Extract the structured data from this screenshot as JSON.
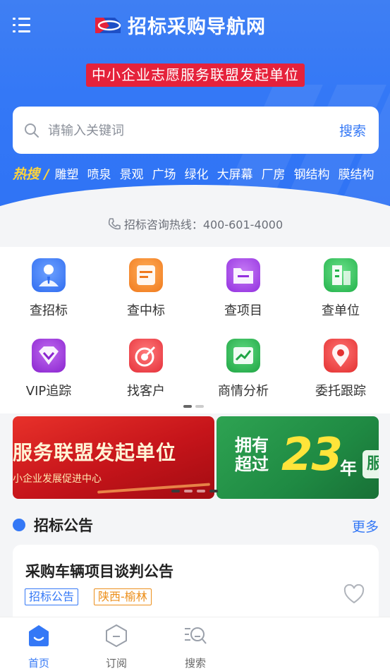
{
  "app": {
    "title": "招标采购导航网"
  },
  "header": {
    "ribbon": "中小企业志愿服务联盟发起单位"
  },
  "search": {
    "placeholder": "请输入关键词",
    "button": "搜索"
  },
  "hot_search": {
    "label": "热搜 /",
    "items": [
      "雕塑",
      "喷泉",
      "景观",
      "广场",
      "绿化",
      "大屏幕",
      "厂房",
      "钢结构",
      "膜结构"
    ]
  },
  "hotline": {
    "text": "招标咨询热线：400-601-4000"
  },
  "grid": [
    {
      "label": "查招标",
      "icon": "person-tie-icon",
      "color": "#3c7cf5"
    },
    {
      "label": "查中标",
      "icon": "badge-card-icon",
      "color": "#f5872a"
    },
    {
      "label": "查项目",
      "icon": "folder-doc-icon",
      "color": "#a23be6"
    },
    {
      "label": "查单位",
      "icon": "building-icon",
      "color": "#2fbf54"
    },
    {
      "label": "VIP追踪",
      "icon": "diamond-icon",
      "color": "#9b2fd8"
    },
    {
      "label": "找客户",
      "icon": "target-icon",
      "color": "#ec3c3f"
    },
    {
      "label": "商情分析",
      "icon": "trend-chart-icon",
      "color": "#23b24a"
    },
    {
      "label": "委托跟踪",
      "icon": "location-pin-icon",
      "color": "#ec3838"
    }
  ],
  "banners": {
    "red": {
      "line1": "服务联盟发起单位",
      "line2": "小企业发展促进中心"
    },
    "green": {
      "line1": "拥有",
      "line2": "超过",
      "number": "23",
      "unit": "年",
      "tail": "服"
    }
  },
  "notice": {
    "title": "招标公告",
    "more": "更多",
    "card": {
      "title": "采购车辆项目谈判公告",
      "tags": [
        "招标公告",
        "陕西-榆林"
      ]
    }
  },
  "bottom_nav": [
    {
      "label": "首页",
      "active": true
    },
    {
      "label": "订阅",
      "active": false
    },
    {
      "label": "搜索",
      "active": false
    }
  ],
  "colors": {
    "brand": "#3478f6",
    "ribbon": "#e5223b",
    "hot_label": "#ffd43b"
  }
}
